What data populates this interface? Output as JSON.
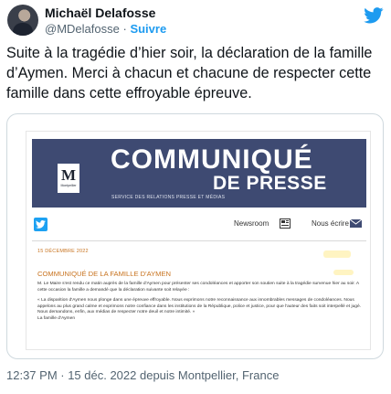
{
  "tweet": {
    "author_name": "Michaël Delafosse",
    "handle": "@MDelafosse",
    "separator": "·",
    "follow_label": "Suivre",
    "text": "Suite à la tragédie d’hier soir, la déclaration de la famille\nd’Aymen. Merci à chacun et chacune de respecter cette\nfamille dans cette effroyable épreuve.",
    "footer": "12:37 PM · 15 déc. 2022 depuis Montpellier, France"
  },
  "document": {
    "banner_title": "COMMUNIQUÉ",
    "banner_subtitle": "DE PRESSE",
    "service": "SERVICE DES RELATIONS PRESSE ET MÉDIAS",
    "logo_letter": "M",
    "logo_label": "Montpellier",
    "newsroom_label": "Newsroom",
    "write_label": "Nous écrire",
    "date": "15 DÉCEMBRE 2022",
    "title": "COMMUNIQUÉ DE LA FAMILLE D'AYMEN",
    "paragraph1": "M. Le Maire s'est rendu ce matin auprès de la famille d'Aymen pour présenter ses condoléances et apporter son soutien suite à la tragédie survenue hier au soir. A cette occasion la famille a demandé que la déclaration suivante soit relayée :",
    "paragraph2": "« La disparition d'Aymen nous plonge dans une épreuve effroyable. Nous exprimons notre reconnaissance aux innombrables messages de condoléances. Nous appelons au plus grand calme et exprimons notre confiance dans les institutions de la République, police et justice, pour que l'auteur des faits soit interpellé et jugé. Nous demandons, enfin, aux médias de respecter notre deuil et notre intimité. »",
    "signature": "La famille d'Aymen"
  },
  "icons": {
    "twitter_bird": "twitter-bird-icon",
    "newsroom": "newsroom-icon",
    "mail": "mail-icon"
  },
  "colors": {
    "twitter_blue": "#1d9bf0",
    "banner": "#3e4a72",
    "accent_orange": "#c8731f"
  }
}
